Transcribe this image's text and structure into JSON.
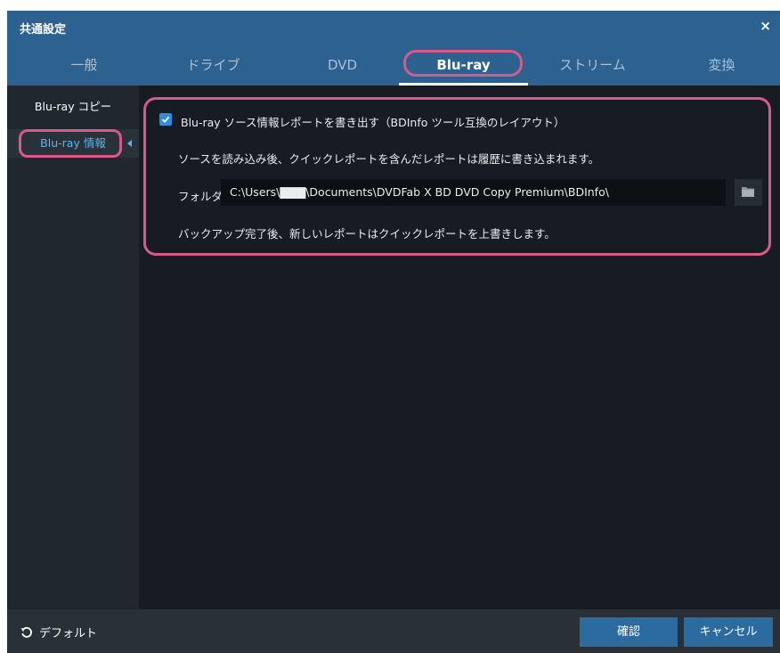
{
  "window": {
    "title": "共通設定",
    "close_label": "×"
  },
  "tabs": [
    {
      "label": "一般"
    },
    {
      "label": "ドライブ"
    },
    {
      "label": "DVD"
    },
    {
      "label": "Blu-ray"
    },
    {
      "label": "ストリーム"
    },
    {
      "label": "変換"
    }
  ],
  "active_tab": "Blu-ray",
  "sidebar": {
    "items": [
      {
        "label": "Blu-ray コピー"
      },
      {
        "label": "Blu-ray 情報"
      }
    ],
    "active_item": "Blu-ray 情報"
  },
  "content": {
    "report_checkbox_label": "Blu-ray ソース情報レポートを書き出す（BDInfo ツール互換のレイアウト）",
    "report_checked": true,
    "description": "ソースを読み込み後、クイックレポートを含んだレポートは履歴に書き込まれます。",
    "folder_label": "フォルダ",
    "folder_path": "C:\\Users\\▇▇▇\\Documents\\DVDFab X BD DVD Copy Premium\\BDInfo\\",
    "note": "バックアップ完了後、新しいレポートはクイックレポートを上書きします。"
  },
  "footer": {
    "default_label": "デフォルト",
    "ok_label": "確認",
    "cancel_label": "キャンセル"
  },
  "icons": {
    "check": "check-icon",
    "folder": "folder-icon",
    "reset": "reset-icon",
    "close": "close-icon"
  },
  "colors": {
    "title_bar": "#2c6190",
    "highlight_outline": "#d95a8a",
    "accent_blue": "#2e8be0",
    "active_sidebar_text": "#5fb1f0",
    "button_bg": "#2c6b9f"
  }
}
